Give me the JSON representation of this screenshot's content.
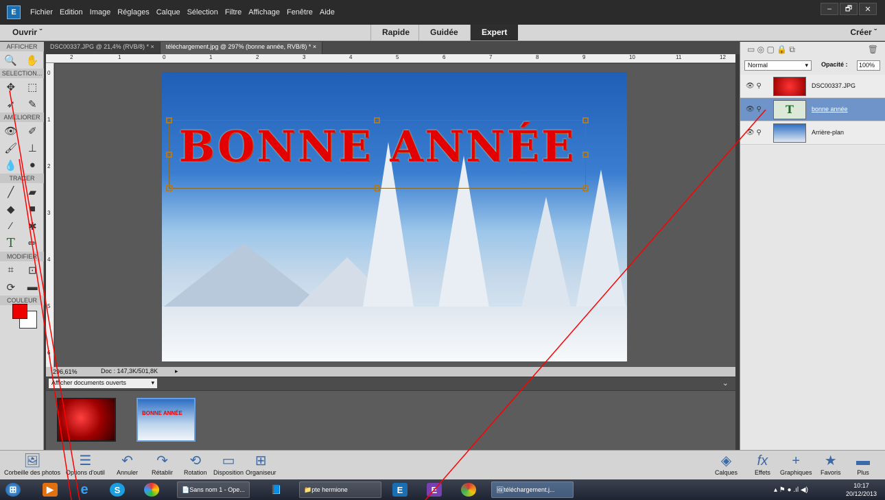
{
  "menu": [
    "Fichier",
    "Edition",
    "Image",
    "Réglages",
    "Calque",
    "Sélection",
    "Filtre",
    "Affichage",
    "Fenêtre",
    "Aide"
  ],
  "window_controls": [
    "–",
    "🗗",
    "✕"
  ],
  "modebar": {
    "open": "Ouvrir  ˇ",
    "modes": [
      "Rapide",
      "Guidée",
      "Expert"
    ],
    "active": "Expert",
    "create": "Créer  ˇ"
  },
  "toolbox": {
    "sections": [
      "AFFICHER",
      "SELECTION...",
      "AMELIORER",
      "TRACER",
      "MODIFIER",
      "COULEUR"
    ]
  },
  "tabs": [
    "DSC00337.JPG @ 21,4% (RVB/8) * ×",
    "téléchargement.jpg @ 297% (bonne année, RVB/8) * ×"
  ],
  "ruler_h": [
    "2",
    "1",
    "0",
    "1",
    "2",
    "3",
    "4",
    "5",
    "6",
    "7",
    "8",
    "9",
    "10",
    "11",
    "12"
  ],
  "ruler_v": [
    "0",
    "1",
    "2",
    "3",
    "4",
    "5",
    "6"
  ],
  "canvas": {
    "text": "BONNE ANNÉE"
  },
  "status": {
    "zoom": "296,61%",
    "doc": "Doc : 147,3K/501,8K"
  },
  "bin": {
    "select": "Afficher documents ouverts",
    "thumb2_text": "BONNE ANNÉE"
  },
  "layers_panel": {
    "blend": "Normal",
    "opacity_label": "Opacité :",
    "opacity": "100%",
    "layers": [
      {
        "name": "DSC00337.JPG"
      },
      {
        "name": "bonne année",
        "selected": true
      },
      {
        "name": "Arrière-plan"
      }
    ]
  },
  "bottom_left": [
    "Corbeille des photos",
    "Options d'outil",
    "Annuler",
    "Rétablir",
    "Rotation",
    "Disposition",
    "Organiseur"
  ],
  "bottom_right": [
    "Calques",
    "Effets",
    "Graphiques",
    "Favoris",
    "Plus"
  ],
  "taskbar": {
    "windows": [
      "Sans nom 1 - Ope...",
      "pte hermione",
      "téléchargement.j..."
    ],
    "time": "10:17",
    "date": "20/12/2013"
  },
  "colors": {
    "foreground": "#e00000",
    "background": "#ffffff",
    "annotation": "#ff0000",
    "selected_layer": "#6e94c9"
  }
}
